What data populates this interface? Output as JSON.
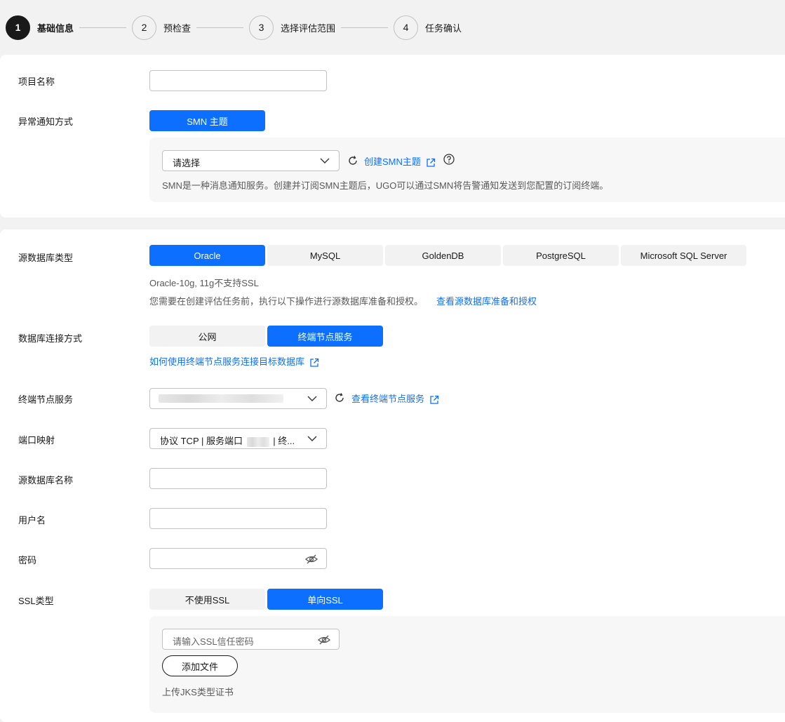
{
  "stepper": {
    "steps": [
      {
        "num": "1",
        "label": "基础信息"
      },
      {
        "num": "2",
        "label": "预检查"
      },
      {
        "num": "3",
        "label": "选择评估范围"
      },
      {
        "num": "4",
        "label": "任务确认"
      }
    ],
    "active_step": 1
  },
  "basic": {
    "project_name_label": "项目名称",
    "project_name_value": "",
    "notify_label": "异常通知方式",
    "notify_option": "SMN 主题",
    "smn_select_value": "请选择",
    "create_smn_link": "创建SMN主题",
    "smn_hint": "SMN是一种消息通知服务。创建并订阅SMN主题后，UGO可以通过SMN将告警通知发送到您配置的订阅终端。"
  },
  "source": {
    "db_type_label": "源数据库类型",
    "db_types": [
      "Oracle",
      "MySQL",
      "GoldenDB",
      "PostgreSQL",
      "Microsoft SQL Server"
    ],
    "db_type_selected": "Oracle",
    "db_type_hint1": "Oracle-10g, 11g不支持SSL",
    "db_type_hint2": "您需要在创建评估任务前，执行以下操作进行源数据库准备和授权。",
    "db_prepare_link": "查看源数据库准备和授权",
    "conn_label": "数据库连接方式",
    "conn_options": [
      "公网",
      "终端节点服务"
    ],
    "conn_selected": "终端节点服务",
    "conn_help_link": "如何使用终端节点服务连接目标数据库",
    "endpoint_label": "终端节点服务",
    "endpoint_link": "查看终端节点服务",
    "port_label": "端口映射",
    "port_value_prefix": "协议 TCP | 服务端口",
    "port_value_suffix": "| 终...",
    "db_name_label": "源数据库名称",
    "db_name_value": "",
    "username_label": "用户名",
    "username_value": "",
    "password_label": "密码",
    "password_value": "",
    "ssl_label": "SSL类型",
    "ssl_options": [
      "不使用SSL",
      "单向SSL"
    ],
    "ssl_selected": "单向SSL",
    "ssl_password_placeholder": "请输入SSL信任密码",
    "add_file_button": "添加文件",
    "upload_hint": "上传JKS类型证书"
  },
  "colors": {
    "primary": "#0d6fff",
    "active_step": "#191919",
    "page_bg": "#f2f2f2"
  }
}
